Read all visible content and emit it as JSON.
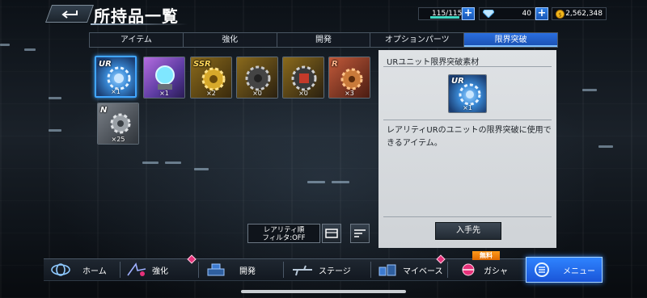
{
  "header": {
    "title": "所持品一覧",
    "energy": "115/115",
    "gems": "40",
    "coins": "2,562,348"
  },
  "tabs": [
    {
      "label": "アイテム"
    },
    {
      "label": "強化"
    },
    {
      "label": "開発"
    },
    {
      "label": "オプションパーツ"
    },
    {
      "label": "限界突破",
      "active": true
    }
  ],
  "items": [
    {
      "rarity": "UR",
      "count": "×1",
      "selected": true
    },
    {
      "rarity": "",
      "count": "×1"
    },
    {
      "rarity": "SSR",
      "count": "×2"
    },
    {
      "rarity": "",
      "count": "×0"
    },
    {
      "rarity": "",
      "count": "×0"
    },
    {
      "rarity": "R",
      "count": "×3"
    },
    {
      "rarity": "N",
      "count": "×25"
    }
  ],
  "detail": {
    "title": "URユニット限界突破素材",
    "item_rarity": "UR",
    "item_count": "×1",
    "description": "レアリティURのユニットの限界突破に使用できるアイテム。",
    "source_button": "入手先"
  },
  "filter": {
    "line1": "レアリティ順",
    "line2": "フィルタ:OFF"
  },
  "nav": [
    {
      "label": "ホーム"
    },
    {
      "label": "強化"
    },
    {
      "label": "開発"
    },
    {
      "label": "ステージ"
    },
    {
      "label": "マイベース"
    },
    {
      "label": "ガシャ"
    },
    {
      "label": "メニュー"
    }
  ],
  "gacha_badge": "無料",
  "colors": {
    "accent_blue": "#2a6fe0",
    "badge_pink": "#e6317a",
    "free_orange": "#ff9a1a",
    "energy_teal": "#3ed7c2"
  }
}
